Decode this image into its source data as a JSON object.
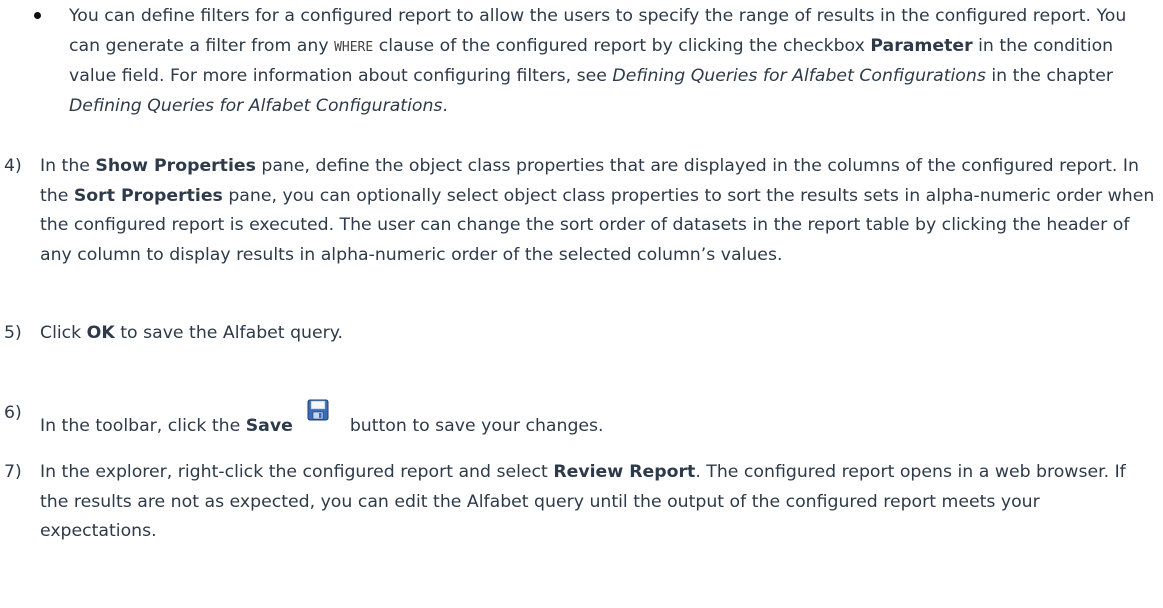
{
  "bullet": {
    "part1": "You can define filters for a configured report to allow the users to specify the range of results in the configured report. You can generate a filter from any ",
    "code": "WHERE",
    "part2": " clause of the configured report by clicking the checkbox ",
    "bold1": "Parameter",
    "part3": " in the condition value field. For more information about configuring filters, see ",
    "italic1": "Defining Queries for Alfabet Configurations",
    "part4": " in the chapter ",
    "italic2": "Defining Queries for Alfabet Configurations",
    "part5": "."
  },
  "steps": [
    {
      "number": "4)",
      "t1": "In the ",
      "b1": "Show Properties",
      "t2": " pane, define the object class properties that are displayed in the columns of the configured report. In the ",
      "b2": "Sort Properties",
      "t3": " pane, you can optionally select object class properties to sort the results sets in alpha-numeric order when the configured report is executed. The user can change the sort order of datasets in the report table by clicking the header of any column to display results in alpha-numeric order of the selected column’s values."
    },
    {
      "number": "5)",
      "t1": "Click ",
      "b1": "OK",
      "t2": " to save the Alfabet query."
    },
    {
      "number": "6)",
      "t1": "In the toolbar, click the ",
      "b1": "Save",
      "icon": "save-icon",
      "t2": "button to save your changes."
    },
    {
      "number": "7)",
      "t1": "In the explorer, right-click the configured report and select ",
      "b1": "Review Report",
      "t2": ". The configured report opens in a web browser. If the results are not as expected, you can edit the Alfabet query until the output of the configured report meets your expectations."
    }
  ]
}
